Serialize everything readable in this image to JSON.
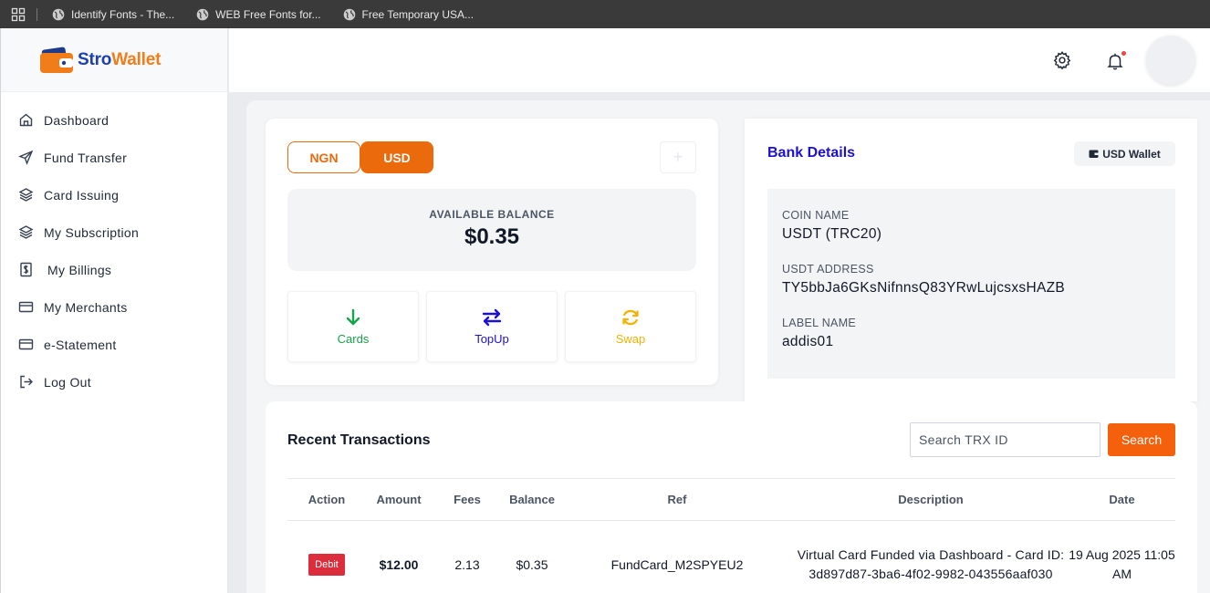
{
  "browser": {
    "bookmarks": [
      {
        "label": "Identify Fonts - The..."
      },
      {
        "label": "WEB Free Fonts for..."
      },
      {
        "label": "Free Temporary USA..."
      }
    ]
  },
  "brand": {
    "name_part1": "Stro",
    "name_part2": "Wallet",
    "primary_color": "#1e40af",
    "accent_color": "#f07d1a"
  },
  "sidebar": {
    "items": [
      {
        "label": "Dashboard",
        "icon": "home-icon"
      },
      {
        "label": "Fund Transfer",
        "icon": "send-icon"
      },
      {
        "label": "Card Issuing",
        "icon": "layers-icon"
      },
      {
        "label": "My Subscription",
        "icon": "layers-icon"
      },
      {
        "label": "My Billings",
        "icon": "dollar-file-icon"
      },
      {
        "label": "My Merchants",
        "icon": "card-icon"
      },
      {
        "label": "e-Statement",
        "icon": "card-icon"
      },
      {
        "label": "Log Out",
        "icon": "logout-icon"
      }
    ]
  },
  "wallet": {
    "tabs": [
      "NGN",
      "USD"
    ],
    "selected_tab": "USD",
    "add_label": "+",
    "balance_label": "AVAILABLE BALANCE",
    "balance_value": "$0.35",
    "actions": {
      "cards": "Cards",
      "topup": "TopUp",
      "swap": "Swap"
    }
  },
  "bank": {
    "title": "Bank Details",
    "wallet_button": "USD Wallet",
    "coin_name_label": "COIN NAME",
    "coin_name": "USDT (TRC20)",
    "address_label": "USDT ADDRESS",
    "address": "TY5bbJa6GKsNifnnsQ83YRwLujcsxsHAZB",
    "label_name_label": "LABEL NAME",
    "label_name": "addis01"
  },
  "transactions": {
    "title": "Recent Transactions",
    "search_placeholder": "Search TRX ID",
    "search_button": "Search",
    "columns": [
      "Action",
      "Amount",
      "Fees",
      "Balance",
      "Ref",
      "Description",
      "Date"
    ],
    "rows": [
      {
        "action": "Debit",
        "amount": "$12.00",
        "fees": "2.13",
        "balance": "$0.35",
        "ref": "FundCard_M2SPYEU2",
        "description": "Virtual Card Funded via Dashboard - Card ID: 3d897d87-3ba6-4f02-9982-043556aaf030",
        "date": "19 Aug 2025 11:05 AM"
      }
    ]
  }
}
